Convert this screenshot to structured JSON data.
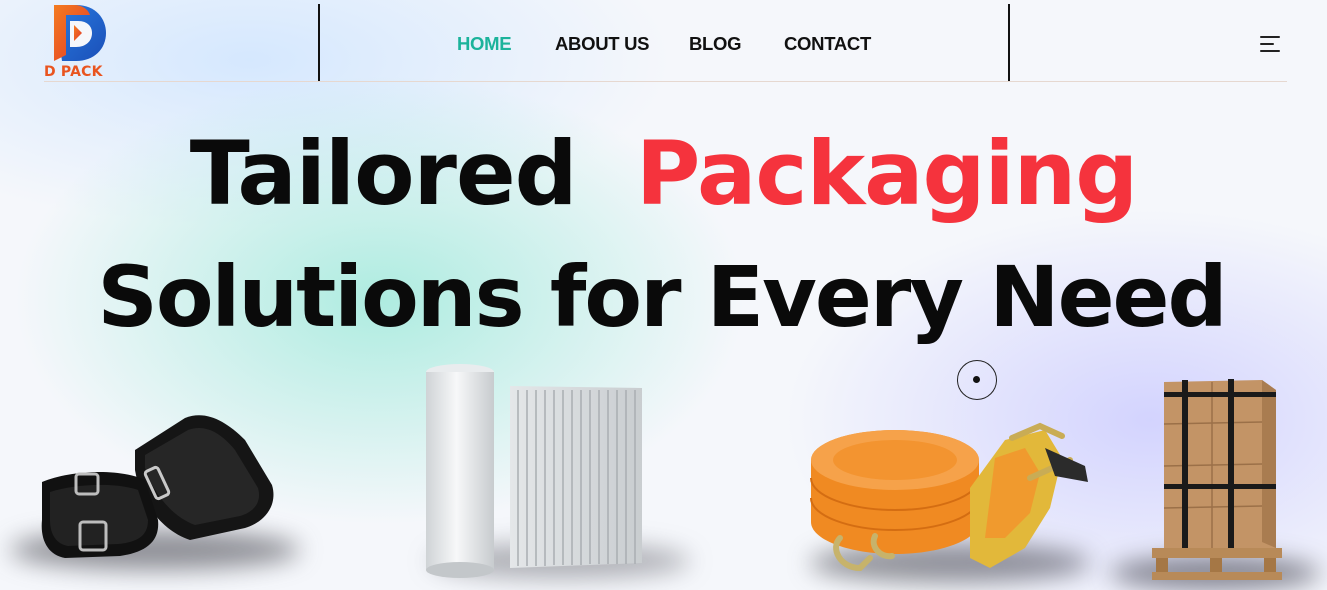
{
  "brand": {
    "name": "D PACK",
    "logo_icon": "d-letter-logo-icon",
    "text_color": "#e9541f"
  },
  "nav": {
    "items": [
      {
        "label": "HOME",
        "active": true
      },
      {
        "label": "ABOUT US",
        "active": false
      },
      {
        "label": "BLOG",
        "active": false
      },
      {
        "label": "CONTACT",
        "active": false
      }
    ],
    "active_color": "#1bb39b",
    "menu_icon": "hamburger-menu-icon"
  },
  "hero": {
    "headline_part1": "Tailored",
    "headline_accent": "Packaging",
    "headline_line2": "Solutions for Every Need",
    "accent_color": "#f5333d"
  },
  "slider": {
    "indicator_icon": "dot-circle-icon"
  },
  "products": [
    {
      "icon": "black-velcro-straps-icon"
    },
    {
      "icon": "air-column-roll-icon"
    },
    {
      "icon": "orange-ratchet-strap-icon"
    },
    {
      "icon": "strapped-pallet-boxes-icon"
    }
  ]
}
